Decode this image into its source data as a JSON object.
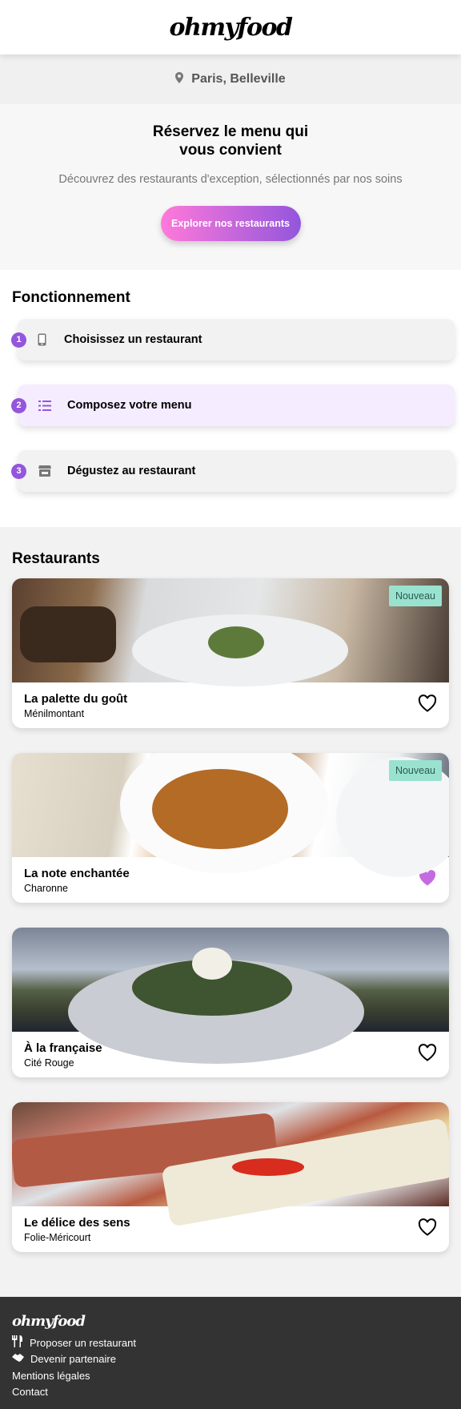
{
  "header": {
    "logo": "ohmyfood"
  },
  "location": {
    "icon": "location-pin-icon",
    "label": "Paris, Belleville"
  },
  "hero": {
    "title": "Réservez le menu qui vous convient",
    "subtitle": "Découvrez des restaurants d'exception, sélectionnés par nos soins",
    "cta_label": "Explorer nos restaurants"
  },
  "how": {
    "title": "Fonctionnement",
    "steps": [
      {
        "number": "1",
        "icon": "mobile-phone-icon",
        "label": "Choisissez un restaurant"
      },
      {
        "number": "2",
        "icon": "list-icon",
        "label": "Composez votre menu"
      },
      {
        "number": "3",
        "icon": "store-icon",
        "label": "Dégustez au restaurant"
      }
    ]
  },
  "restaurants": {
    "title": "Restaurants",
    "items": [
      {
        "name": "La palette du goût",
        "area": "Ménilmontant",
        "badge": "Nouveau",
        "liked": false
      },
      {
        "name": "La note enchantée",
        "area": "Charonne",
        "badge": "Nouveau",
        "liked": true
      },
      {
        "name": "À la française",
        "area": "Cité Rouge",
        "badge": "",
        "liked": false
      },
      {
        "name": "Le délice des sens",
        "area": "Folie-Méricourt",
        "badge": "",
        "liked": false
      }
    ]
  },
  "footer": {
    "logo": "ohmyfood",
    "links": [
      {
        "icon": "utensils-icon",
        "label": "Proposer un restaurant"
      },
      {
        "icon": "handshake-icon",
        "label": "Devenir partenaire"
      },
      {
        "icon": "",
        "label": "Mentions légales"
      },
      {
        "icon": "",
        "label": "Contact"
      }
    ]
  },
  "colors": {
    "accent": "#9356dc",
    "gradient_start": "#ff79da",
    "badge_bg": "#99e2d0",
    "liked_heart": "#c36be0",
    "footer_bg": "#333333"
  }
}
